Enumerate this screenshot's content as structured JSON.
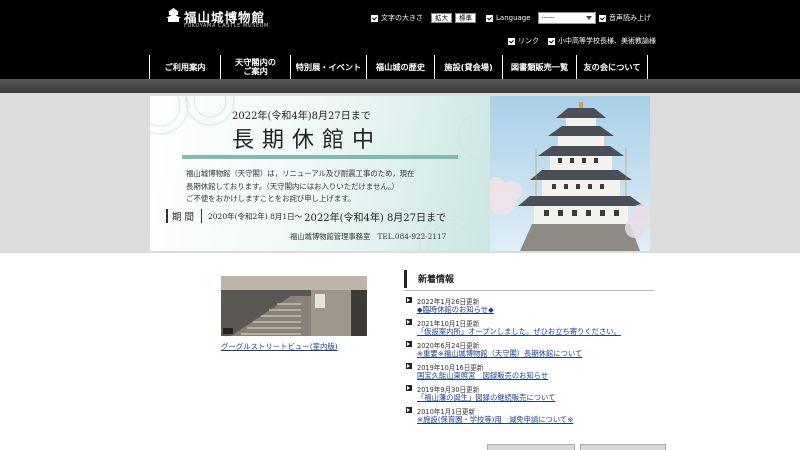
{
  "header": {
    "logo_text": "福山城博物館",
    "logo_sub": "FUKUYAMA CASTLE MUSEUM",
    "font_size_label": "文字の大きさ",
    "font_size_large": "拡大",
    "font_size_standard": "標準",
    "language_label": "Language",
    "language_value": "------",
    "read_aloud_label": "音声読み上げ",
    "link_label": "リンク",
    "school_label": "小中高等学校長様、美術教諭様"
  },
  "nav": [
    {
      "label": "ご利用案内"
    },
    {
      "label1": "天守閣内の",
      "label2": "ご案内"
    },
    {
      "label": "特別展・イベント"
    },
    {
      "label": "福山城の歴史"
    },
    {
      "label": "施設(貸会場)"
    },
    {
      "label": "図書類販売一覧"
    },
    {
      "label": "友の会について"
    }
  ],
  "banner": {
    "date": "2022年(令和4年)8月27日まで",
    "title": "長期休館中",
    "body1": "福山城博物館（天守閣）は，リニューアル及び耐震工事のため，現在",
    "body2": "長期休館しております。（天守閣内にはお入りいただけません。）",
    "body3": "ご不便をおかけしますことをお詫び申し上げます。",
    "period_label": "期間",
    "period_start": "2020年(令和2年) 8月1日～",
    "period_end": "2022年(令和4年) 8月27日まで",
    "office": "福山城博物館管理事務室　TEL.084-922-2117"
  },
  "streetview": {
    "link": "グーグルストリートビュー(室内版)"
  },
  "news": {
    "title": "新着情報",
    "items": [
      {
        "date": "2022年1月26日更新",
        "link": "◆臨時休館のお知らせ◆"
      },
      {
        "date": "2021年10月1日更新",
        "link": "「仮設案内所」オープンしました。ぜひお立ち寄りください。"
      },
      {
        "date": "2020年6月24日更新",
        "link": "※重要※福山城博物館（天守閣）長期休館について"
      },
      {
        "date": "2019年10月16日更新",
        "link": "国宝久能山東照宮　図録販売のお知らせ"
      },
      {
        "date": "2019年9月30日更新",
        "link": "「福山藩の誕生」図録の継続販売について"
      },
      {
        "date": "2010年1月1日更新",
        "link": "※施設(保育園・学校等)用　減免申請について※"
      }
    ]
  },
  "colors": {
    "header_bg": "#000000",
    "link": "#1a3f8f",
    "banner_accent": "#7fbab3"
  }
}
